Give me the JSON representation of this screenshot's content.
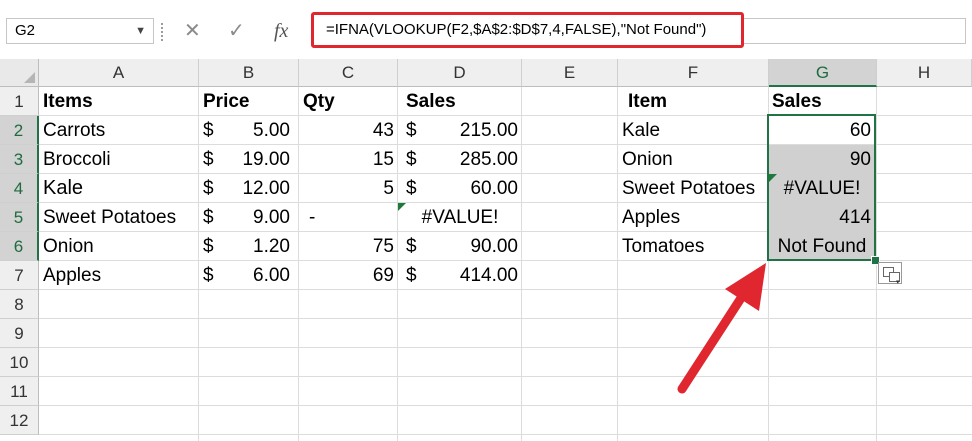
{
  "formula_bar": {
    "name_box": "G2",
    "cancel_icon": "✕",
    "enter_icon": "✓",
    "function_icon": "fx",
    "formula": "=IFNA(VLOOKUP(F2,$A$2:$D$7,4,FALSE),\"Not Found\")"
  },
  "sheet": {
    "columns": [
      "A",
      "B",
      "C",
      "D",
      "E",
      "F",
      "G",
      "H"
    ],
    "selected_column": "G",
    "rows": [
      "1",
      "2",
      "3",
      "4",
      "5",
      "6",
      "7",
      "8",
      "9",
      "10",
      "11",
      "12"
    ],
    "selected_rows": [
      "2",
      "3",
      "4",
      "5",
      "6"
    ],
    "headers": {
      "items": "Items",
      "price": "Price",
      "qty": "Qty",
      "sales": "Sales",
      "item": "Item",
      "lookup_sales": "Sales"
    },
    "data": [
      {
        "item": "Carrots",
        "currency": "$",
        "price": "5.00",
        "qty": "43",
        "sales_currency": "$",
        "sales": "215.00"
      },
      {
        "item": "Broccoli",
        "currency": "$",
        "price": "19.00",
        "qty": "15",
        "sales_currency": "$",
        "sales": "285.00"
      },
      {
        "item": "Kale",
        "currency": "$",
        "price": "12.00",
        "qty": "5",
        "sales_currency": "$",
        "sales": "60.00"
      },
      {
        "item": "Sweet Potatoes",
        "currency": "$",
        "price": "9.00",
        "qty": "-",
        "sales_currency": "",
        "sales": "#VALUE!"
      },
      {
        "item": "Onion",
        "currency": "$",
        "price": "1.20",
        "qty": "75",
        "sales_currency": "$",
        "sales": "90.00"
      },
      {
        "item": "Apples",
        "currency": "$",
        "price": "6.00",
        "qty": "69",
        "sales_currency": "$",
        "sales": "414.00"
      }
    ],
    "lookup": [
      {
        "item": "Kale",
        "sales": "60"
      },
      {
        "item": "Onion",
        "sales": "90"
      },
      {
        "item": "Sweet Potatoes",
        "sales": "#VALUE!"
      },
      {
        "item": "Apples",
        "sales": "414"
      },
      {
        "item": "Tomatoes",
        "sales": "Not Found"
      }
    ]
  },
  "colors": {
    "highlight_box": "#e0262f",
    "arrow": "#e0262f",
    "selection": "#217346",
    "selection_fill": "#d0d0d0",
    "error_triangle": "#1d7a3a"
  }
}
